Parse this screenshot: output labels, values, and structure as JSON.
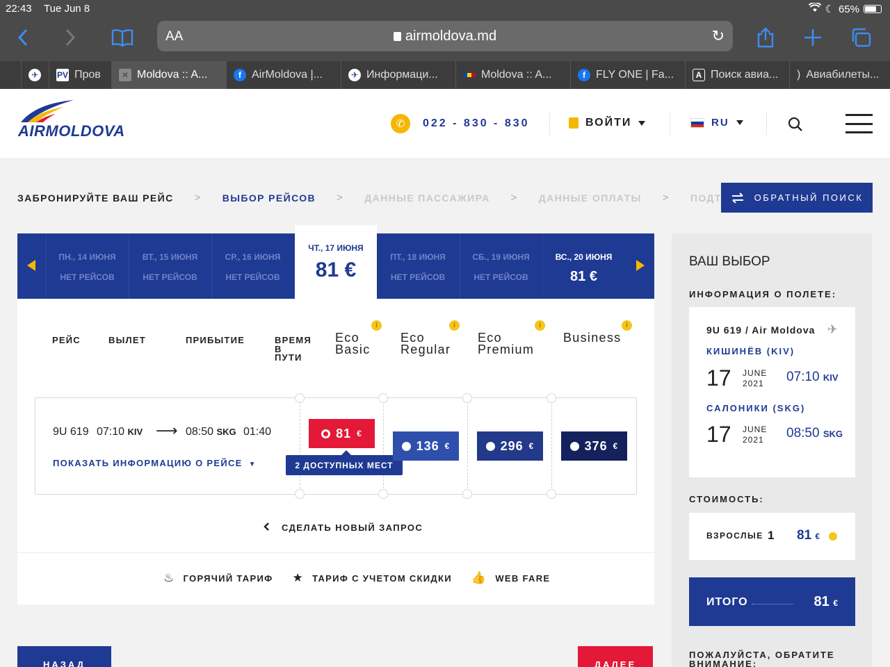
{
  "status": {
    "time": "22:43",
    "date": "Tue Jun 8",
    "battery": "65%"
  },
  "browser": {
    "aa": "AA",
    "url": "airmoldova.md",
    "tabs": [
      {
        "label": "",
        "icon": "airmoldova-icon"
      },
      {
        "label": "Пров",
        "icon": "pv-icon"
      },
      {
        "label": "Moldova :: A...",
        "icon": "close-icon",
        "active": true
      },
      {
        "label": "AirMoldova |...",
        "icon": "facebook-icon"
      },
      {
        "label": "Информаци...",
        "icon": "airmoldova-icon"
      },
      {
        "label": "Moldova :: A...",
        "icon": "flag-icon"
      },
      {
        "label": "FLY ONE | Fa...",
        "icon": "facebook-icon"
      },
      {
        "label": "Поиск авиа...",
        "icon": "a-icon"
      },
      {
        "label": "Авиабилеты...",
        "icon": "bracket-icon"
      }
    ]
  },
  "header": {
    "logo": "AIRMOLDOVA",
    "phone": "022 - 830 - 830",
    "login": "ВОЙТИ",
    "lang": "RU"
  },
  "breadcrumb": {
    "items": [
      "ЗАБРОНИРУЙТЕ ВАШ РЕЙС",
      "ВЫБОР РЕЙСОВ",
      "ДАННЫЕ ПАССАЖИРА",
      "ДАННЫЕ ОПЛАТЫ",
      "ПОДТВЕРЖДЕНИЕ"
    ],
    "reverse_search": "ОБРАТНЫЙ ПОИСК"
  },
  "dates": [
    {
      "day": "ПН., 14 ИЮНЯ",
      "status": "НЕТ РЕЙСОВ"
    },
    {
      "day": "ВТ., 15 ИЮНЯ",
      "status": "НЕТ РЕЙСОВ"
    },
    {
      "day": "СР., 16 ИЮНЯ",
      "status": "НЕТ РЕЙСОВ"
    },
    {
      "day": "ЧТ., 17 ИЮНЯ",
      "price": "81 €",
      "selected": true
    },
    {
      "day": "ПТ., 18 ИЮНЯ",
      "status": "НЕТ РЕЙСОВ"
    },
    {
      "day": "СБ., 19 ИЮНЯ",
      "status": "НЕТ РЕЙСОВ"
    },
    {
      "day": "ВС., 20 ИЮНЯ",
      "price": "81 €"
    }
  ],
  "columns": {
    "flight": "РЕЙС",
    "departure": "ВЫЛЕТ",
    "arrival": "ПРИБЫТИЕ",
    "duration_1": "ВРЕМЯ",
    "duration_2": "В",
    "duration_3": "ПУТИ",
    "fares": [
      {
        "l1": "Eco",
        "l2": "Basic"
      },
      {
        "l1": "Eco",
        "l2": "Regular"
      },
      {
        "l1": "Eco",
        "l2": "Premium"
      },
      {
        "l1": "Business",
        "l2": ""
      }
    ]
  },
  "flight": {
    "number": "9U 619",
    "dep_time": "07:10",
    "dep_code": "KIV",
    "arr_time": "08:50",
    "arr_code": "SKG",
    "duration": "01:40",
    "show_info": "ПОКАЗАТЬ ИНФОРМАЦИЮ О РЕЙСЕ",
    "prices": [
      "81",
      "136",
      "296",
      "376"
    ],
    "currency": "€",
    "seats": "2 ДОСТУПНЫХ МЕСТ"
  },
  "actions": {
    "new_search": "СДЕЛАТЬ НОВЫЙ ЗАПРОС",
    "back": "НАЗАД",
    "next": "ДАЛЕЕ"
  },
  "legend": [
    "ГОРЯЧИЙ ТАРИФ",
    "ТАРИФ С УЧЕТОМ СКИДКИ",
    "WEB FARE"
  ],
  "sidebar": {
    "title": "ВАШ ВЫБОР",
    "flight_info_label": "ИНФОРМАЦИЯ О ПОЛЕТЕ:",
    "flight_line": "9U 619 / Air Moldova",
    "origin_city": "КИШИНЁВ (KIV)",
    "origin_day": "17",
    "origin_month": "JUNE",
    "origin_year": "2021",
    "origin_time": "07:10",
    "origin_code": "KIV",
    "dest_city": "САЛОНИКИ (SKG)",
    "dest_day": "17",
    "dest_month": "JUNE",
    "dest_year": "2021",
    "dest_time": "08:50",
    "dest_code": "SKG",
    "cost_label": "СТОИМОСТЬ:",
    "adults_label": "ВЗРОСЛЫЕ",
    "adults_count": "1",
    "adults_price": "81",
    "total_label": "ИТОГО",
    "total_price": "81",
    "note": "ПОЖАЛУЙСТА, ОБРАТИТЕ ВНИМАНИЕ:"
  },
  "colors": {
    "brand_blue": "#1f3a93",
    "accent_yellow": "#f5b700",
    "selected_red": "#e31937",
    "fare_blue_1": "#2f4fad",
    "fare_blue_2": "#23398a",
    "fare_blue_3": "#14215c"
  }
}
